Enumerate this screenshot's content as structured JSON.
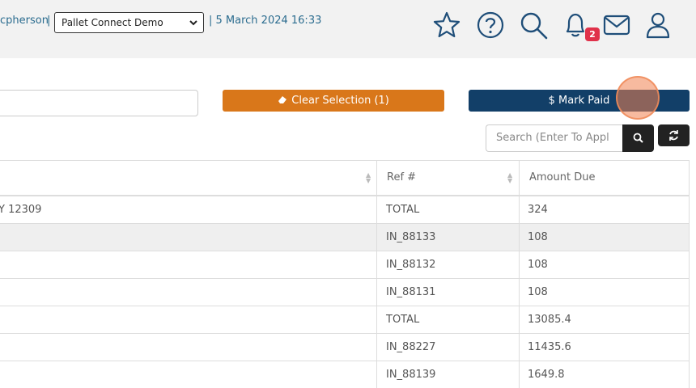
{
  "header": {
    "user_fragment": "cpherson",
    "separator": "|",
    "company_select": "Pallet Connect Demo",
    "datetime": "| 5 March 2024 16:33",
    "notification_count": "2"
  },
  "actions": {
    "clear_selection": "Clear Selection (1)",
    "mark_paid": "$ Mark Paid"
  },
  "table_search": {
    "placeholder": "Search (Enter To Appl"
  },
  "table": {
    "columns": [
      "",
      "Ref #",
      "Amount Due"
    ],
    "rows": [
      {
        "name": "Y 12309",
        "ref": "TOTAL",
        "amount": "324"
      },
      {
        "name": "",
        "ref": "IN_88133",
        "amount": "108"
      },
      {
        "name": "",
        "ref": "IN_88132",
        "amount": "108"
      },
      {
        "name": "",
        "ref": "IN_88131",
        "amount": "108"
      },
      {
        "name": "",
        "ref": "TOTAL",
        "amount": "13085.4"
      },
      {
        "name": "",
        "ref": "IN_88227",
        "amount": "11435.6"
      },
      {
        "name": "",
        "ref": "IN_88139",
        "amount": "1649.8"
      }
    ]
  },
  "colors": {
    "accent_blue": "#123f68",
    "accent_orange": "#d9771a",
    "badge_red": "#e0314a",
    "link_blue": "#2b6c8f"
  }
}
